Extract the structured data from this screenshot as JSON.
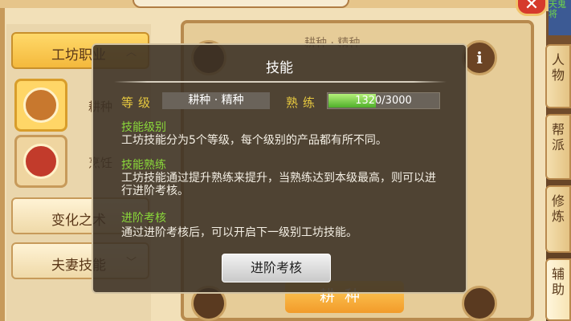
{
  "background": {
    "categories": [
      {
        "label": "工坊职业",
        "selected": true
      },
      {
        "label": "变化之术",
        "selected": false
      },
      {
        "label": "夫妻技能",
        "selected": false
      }
    ],
    "skill_items": [
      {
        "label": "耕种",
        "icon": "wheat-icon"
      },
      {
        "label": "烹饪",
        "icon": "cooking-pan-icon"
      }
    ],
    "wheel_header": "耕种 · 精种",
    "footer_button": "耕种",
    "close_symbol": "✕",
    "info_symbol": "i",
    "side_tabs": [
      "人物",
      "帮派",
      "修炼",
      "辅助"
    ],
    "corner_text": "天鬼将"
  },
  "dialog": {
    "title": "技能",
    "level_label": "等级",
    "level_value": "耕种 · 精种",
    "proficiency_label": "熟练",
    "proficiency_current": 1320,
    "proficiency_max": 3000,
    "proficiency_text": "1320/3000",
    "sections": [
      {
        "title": "技能级别",
        "body": "工坊技能分为5个等级，每个级别的产品都有所不同。"
      },
      {
        "title": "技能熟练",
        "body": "工坊技能通过提升熟练来提升，当熟练达到本级最高，则可以进行进阶考核。"
      },
      {
        "title": "进阶考核",
        "body": "通过进阶考核后，可以开启下一级别工坊技能。"
      }
    ],
    "button_label": "进阶考核"
  },
  "colors": {
    "accent_yellow": "#e7c93f",
    "section_green": "#8ad83a",
    "progress_green": "#4fb02a"
  }
}
